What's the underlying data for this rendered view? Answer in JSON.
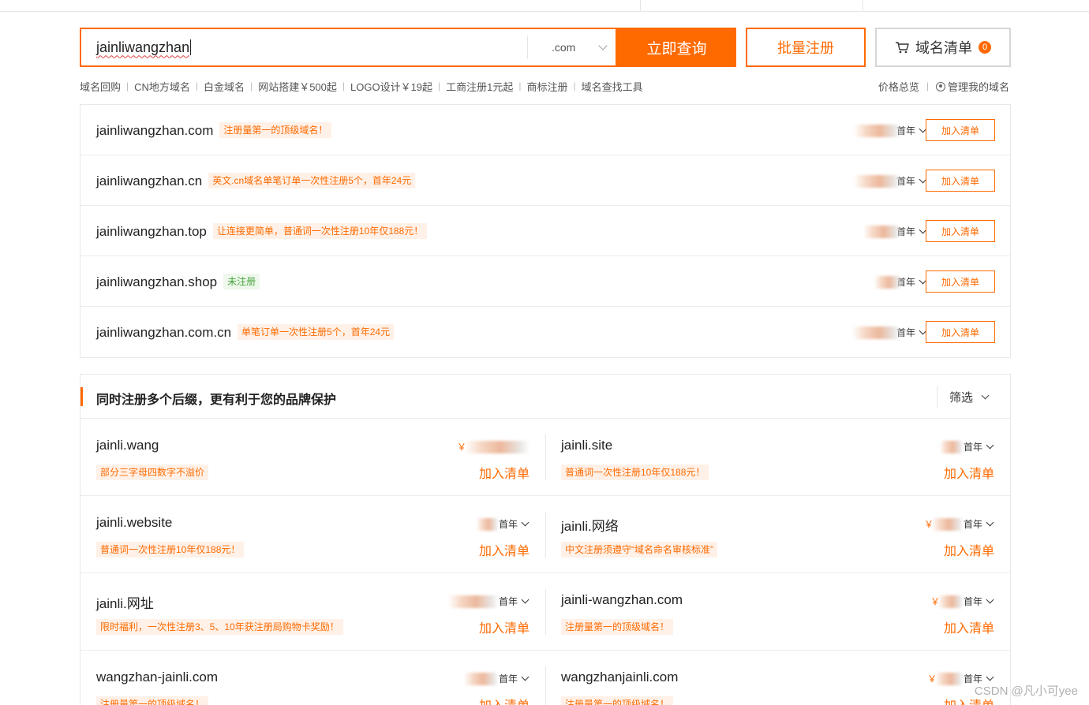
{
  "search": {
    "query": "jainliwangzhan",
    "suffix": ".com",
    "search_button": "立即查询",
    "bulk_button": "批量注册",
    "cart_label": "域名清单",
    "cart_count": "0"
  },
  "quick_links": [
    "域名回购",
    "CN地方域名",
    "白金域名",
    "网站搭建￥500起",
    "LOGO设计￥19起",
    "工商注册1元起",
    "商标注册",
    "域名查找工具"
  ],
  "right_links": {
    "price_overview": "价格总览",
    "manage_domains": "管理我的域名"
  },
  "results": [
    {
      "domain": "jainliwangzhan.com",
      "tag": "注册量第一的顶级域名！",
      "tag_style": "orange",
      "period": "首年",
      "add": "加入清单"
    },
    {
      "domain": "jainliwangzhan.cn",
      "tag": "英文.cn域名单笔订单一次性注册5个，首年24元",
      "tag_style": "orange",
      "period": "首年",
      "add": "加入清单"
    },
    {
      "domain": "jainliwangzhan.top",
      "tag": "让连接更简单，普通词一次性注册10年仅188元！",
      "tag_style": "orange",
      "period": "首年",
      "add": "加入清单"
    },
    {
      "domain": "jainliwangzhan.shop",
      "tag": "未注册",
      "tag_style": "green",
      "period": "首年",
      "add": "加入清单"
    },
    {
      "domain": "jainliwangzhan.com.cn",
      "tag": "单笔订单一次性注册5个，首年24元",
      "tag_style": "orange",
      "period": "首年",
      "add": "加入清单"
    }
  ],
  "suggest": {
    "title": "同时注册多个后缀，更有利于您的品牌保护",
    "filter": "筛选",
    "items": [
      {
        "domain": "jainli.wang",
        "tag": "部分三字母四数字不溢价",
        "yen": "￥",
        "period": "",
        "add": "加入清单"
      },
      {
        "domain": "jainli.site",
        "tag": "普通词一次性注册10年仅188元！",
        "yen": "",
        "period": "首年",
        "add": "加入清单"
      },
      {
        "domain": "jainli.website",
        "tag": "普通词一次性注册10年仅188元！",
        "yen": "",
        "period": "首年",
        "add": "加入清单"
      },
      {
        "domain": "jainli.网络",
        "tag": "中文注册须遵守“域名命名审核标准”",
        "yen": "￥",
        "period": "首年",
        "add": "加入清单"
      },
      {
        "domain": "jainli.网址",
        "tag": "限时福利，一次性注册3、5、10年获注册局购物卡奖励！",
        "yen": "",
        "period": "首年",
        "add": "加入清单"
      },
      {
        "domain": "jainli-wangzhan.com",
        "tag": "注册量第一的顶级域名！",
        "yen": "￥",
        "period": "首年",
        "add": "加入清单"
      },
      {
        "domain": "wangzhan-jainli.com",
        "tag": "注册量第一的顶级域名！",
        "yen": "",
        "period": "首年",
        "add": "加入清单"
      },
      {
        "domain": "wangzhanjainli.com",
        "tag": "注册量第一的顶级域名！",
        "yen": "￥",
        "period": "首年",
        "add": "加入清单"
      }
    ]
  },
  "watermark": "CSDN @凡小可yee"
}
